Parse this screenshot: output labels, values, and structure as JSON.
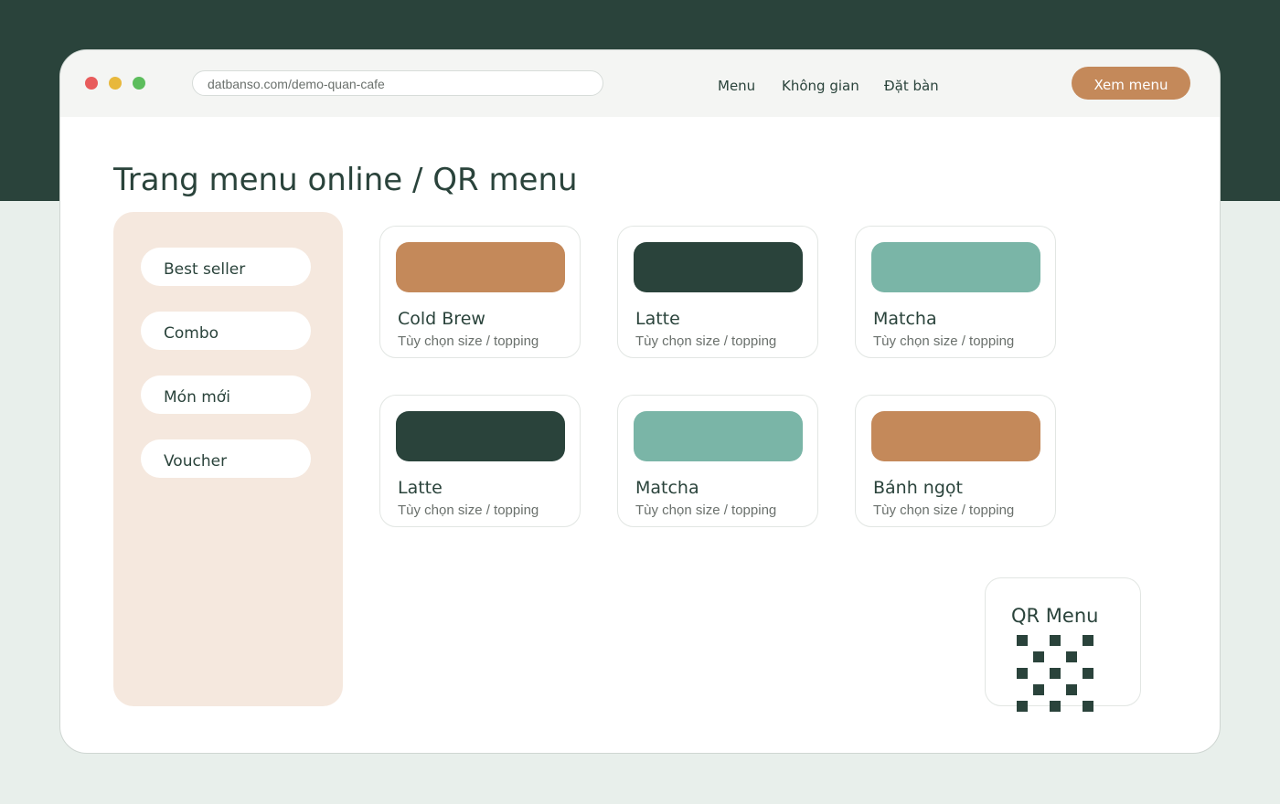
{
  "browser": {
    "url": "datbanso.com/demo-quan-cafe"
  },
  "nav": {
    "links": [
      "Menu",
      "Không gian",
      "Đặt bàn"
    ],
    "cta_label": "Xem menu"
  },
  "page": {
    "title": "Trang menu online / QR menu"
  },
  "sidebar": {
    "categories": [
      "Best seller",
      "Combo",
      "Món mới",
      "Voucher"
    ]
  },
  "menu_items": [
    {
      "name": "Cold Brew",
      "subtitle": "Tùy chọn size / topping",
      "color": "#c4895a"
    },
    {
      "name": "Latte",
      "subtitle": "Tùy chọn size / topping",
      "color": "#2a433b"
    },
    {
      "name": "Matcha",
      "subtitle": "Tùy chọn size / topping",
      "color": "#7ab5a7"
    },
    {
      "name": "Latte",
      "subtitle": "Tùy chọn size / topping",
      "color": "#2a433b"
    },
    {
      "name": "Matcha",
      "subtitle": "Tùy chọn size / topping",
      "color": "#7ab5a7"
    },
    {
      "name": "Bánh ngọt",
      "subtitle": "Tùy chọn size / topping",
      "color": "#c4895a"
    }
  ],
  "qr": {
    "title": "QR Menu"
  },
  "colors": {
    "brand_dark": "#2a433b",
    "accent": "#c4895a",
    "mint": "#7ab5a7",
    "sidebar_bg": "#f5e8de",
    "page_bg": "#e8efeb"
  }
}
